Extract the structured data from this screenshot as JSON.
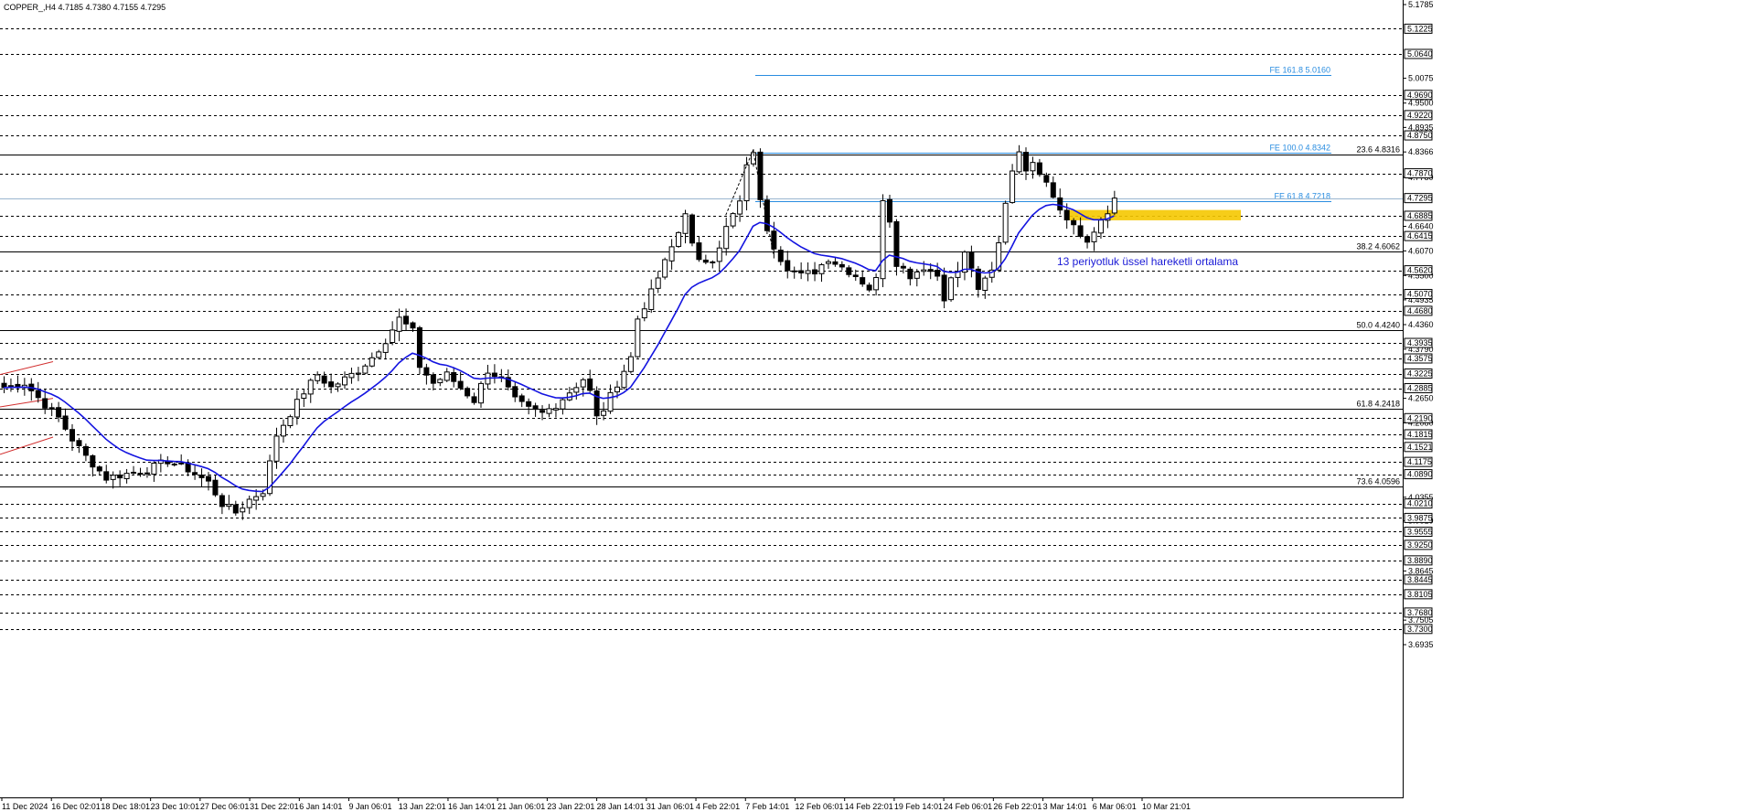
{
  "header": {
    "symbol_text": "COPPER_,H4  4.7185 4.7380 4.7155 4.7295"
  },
  "chart_data": {
    "type": "candlestick",
    "ylim": [
      3.6935,
      5.1785
    ],
    "x_ticks": [
      "11 Dec 2024",
      "16 Dec 02:01",
      "18 Dec 18:01",
      "23 Dec 10:01",
      "27 Dec 06:01",
      "31 Dec 22:01",
      "6 Jan 14:01",
      "9 Jan 06:01",
      "13 Jan 22:01",
      "16 Jan 14:01",
      "21 Jan 06:01",
      "23 Jan 22:01",
      "28 Jan 14:01",
      "31 Jan 06:01",
      "4 Feb 22:01",
      "7 Feb 14:01",
      "12 Feb 06:01",
      "14 Feb 22:01",
      "19 Feb 14:01",
      "24 Feb 06:01",
      "26 Feb 22:01",
      "3 Mar 14:01",
      "6 Mar 06:01",
      "10 Mar 21:01"
    ],
    "y_ticks_plain": [
      "5.1785",
      "5.0075",
      "4.9500",
      "4.8935",
      "4.8366",
      "4.7780",
      "4.6640",
      "4.6070",
      "4.5500",
      "4.4935",
      "4.4360",
      "4.3790",
      "4.2650",
      "4.2080",
      "4.0355",
      "3.9810",
      "3.8645",
      "3.7505",
      "3.6935"
    ],
    "y_ticks_boxed": [
      "5.1225",
      "5.0640",
      "4.9690",
      "4.9220",
      "4.8750",
      "4.7870",
      "4.7295",
      "4.6885",
      "4.6415",
      "4.5620",
      "4.5070",
      "4.4680",
      "4.3935",
      "4.3575",
      "4.3225",
      "4.2885",
      "4.2190",
      "4.1815",
      "4.1521",
      "4.1175",
      "4.0890",
      "4.0210",
      "3.9875",
      "3.9555",
      "3.9250",
      "3.8890",
      "3.8445",
      "3.8105",
      "3.7680",
      "3.7300"
    ],
    "dashed_levels": [
      5.1225,
      5.064,
      4.969,
      4.922,
      4.875,
      4.787,
      4.6885,
      4.6415,
      4.562,
      4.507,
      4.468,
      4.3935,
      4.3575,
      4.3225,
      4.2885,
      4.219,
      4.1815,
      4.1521,
      4.1175,
      4.089,
      4.021,
      3.9875,
      3.9555,
      3.925,
      3.889,
      3.8445,
      3.8105,
      3.768,
      3.73
    ],
    "fib_retracement": [
      {
        "label": "23.6 4.8316",
        "value": 4.8316
      },
      {
        "label": "38.2 4.6062",
        "value": 4.6062
      },
      {
        "label": "50.0 4.4240",
        "value": 4.424
      },
      {
        "label": "61.8 4.2418",
        "value": 4.2418
      },
      {
        "label": "73.6 4.0596",
        "value": 4.0596
      }
    ],
    "fib_expansion": [
      {
        "label": "FE 161.8 5.0160",
        "value": 5.016
      },
      {
        "label": "FE 100.0 4.8342",
        "value": 4.8342
      },
      {
        "label": "FE 61.8 4.7218",
        "value": 4.7218
      }
    ],
    "support_zone": [
      4.678,
      4.702
    ],
    "current_price": 4.7295,
    "ema_label": "13 periyotluk üssel hareketli ortalama",
    "ema_period": 13,
    "close_path": [
      [
        0,
        4.29
      ],
      [
        3,
        4.3
      ],
      [
        6,
        4.25
      ],
      [
        8,
        4.22
      ],
      [
        10,
        4.17
      ],
      [
        12,
        4.13
      ],
      [
        15,
        4.08
      ],
      [
        18,
        4.09
      ],
      [
        21,
        4.1
      ],
      [
        24,
        4.12
      ],
      [
        27,
        4.1
      ],
      [
        30,
        4.07
      ],
      [
        32,
        4.02
      ],
      [
        34,
        4.0
      ],
      [
        36,
        4.03
      ],
      [
        38,
        4.05
      ],
      [
        40,
        4.18
      ],
      [
        42,
        4.23
      ],
      [
        44,
        4.28
      ],
      [
        46,
        4.32
      ],
      [
        48,
        4.29
      ],
      [
        50,
        4.31
      ],
      [
        52,
        4.33
      ],
      [
        54,
        4.36
      ],
      [
        56,
        4.4
      ],
      [
        58,
        4.45
      ],
      [
        60,
        4.42
      ],
      [
        61,
        4.34
      ],
      [
        63,
        4.3
      ],
      [
        65,
        4.32
      ],
      [
        67,
        4.29
      ],
      [
        69,
        4.26
      ],
      [
        71,
        4.33
      ],
      [
        73,
        4.31
      ],
      [
        75,
        4.26
      ],
      [
        77,
        4.24
      ],
      [
        79,
        4.23
      ],
      [
        81,
        4.25
      ],
      [
        83,
        4.28
      ],
      [
        85,
        4.31
      ],
      [
        86,
        4.28
      ],
      [
        87,
        4.22
      ],
      [
        88,
        4.24
      ],
      [
        90,
        4.3
      ],
      [
        92,
        4.36
      ],
      [
        93,
        4.45
      ],
      [
        95,
        4.51
      ],
      [
        97,
        4.58
      ],
      [
        99,
        4.65
      ],
      [
        100,
        4.7
      ],
      [
        101,
        4.62
      ],
      [
        102,
        4.58
      ],
      [
        104,
        4.59
      ],
      [
        105,
        4.62
      ],
      [
        106,
        4.66
      ],
      [
        107,
        4.69
      ],
      [
        108,
        4.72
      ],
      [
        109,
        4.8
      ],
      [
        110,
        4.84
      ],
      [
        111,
        4.72
      ],
      [
        112,
        4.66
      ],
      [
        113,
        4.62
      ],
      [
        114,
        4.59
      ],
      [
        115,
        4.57
      ],
      [
        117,
        4.55
      ],
      [
        119,
        4.56
      ],
      [
        121,
        4.59
      ],
      [
        123,
        4.57
      ],
      [
        125,
        4.55
      ],
      [
        127,
        4.52
      ],
      [
        128,
        4.54
      ],
      [
        129,
        4.73
      ],
      [
        130,
        4.68
      ],
      [
        131,
        4.58
      ],
      [
        133,
        4.55
      ],
      [
        135,
        4.57
      ],
      [
        137,
        4.55
      ],
      [
        138,
        4.5
      ],
      [
        139,
        4.54
      ],
      [
        140,
        4.56
      ],
      [
        141,
        4.6
      ],
      [
        142,
        4.57
      ],
      [
        143,
        4.51
      ],
      [
        144,
        4.54
      ],
      [
        145,
        4.56
      ],
      [
        146,
        4.63
      ],
      [
        147,
        4.72
      ],
      [
        148,
        4.8
      ],
      [
        149,
        4.83
      ],
      [
        150,
        4.8
      ],
      [
        151,
        4.82
      ],
      [
        152,
        4.79
      ],
      [
        153,
        4.77
      ],
      [
        154,
        4.74
      ],
      [
        155,
        4.7
      ],
      [
        156,
        4.68
      ],
      [
        157,
        4.67
      ],
      [
        158,
        4.64
      ],
      [
        159,
        4.62
      ],
      [
        160,
        4.65
      ],
      [
        161,
        4.68
      ],
      [
        162,
        4.7
      ],
      [
        163,
        4.73
      ]
    ]
  }
}
